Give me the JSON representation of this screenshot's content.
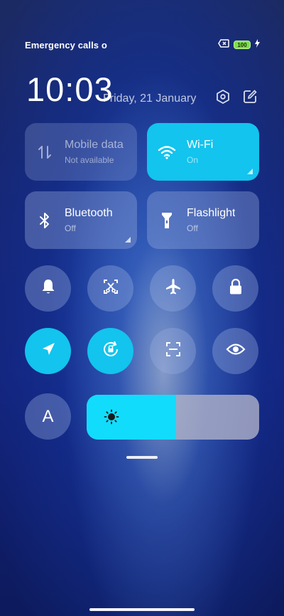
{
  "status_bar": {
    "carrier_text": "Emergency calls o",
    "carrier_text_faded": "",
    "battery_level": "100",
    "icons": [
      "no-sim-icon",
      "battery-icon",
      "charging-bolt-icon"
    ]
  },
  "header": {
    "time": "10:03",
    "date": "Friday, 21 January",
    "icons": [
      "settings-hexagon-icon",
      "edit-icon"
    ]
  },
  "tiles": [
    {
      "key": "mobile_data",
      "label": "Mobile data",
      "status": "Not available",
      "state": "disabled",
      "icon": "mobile-data-arrows-icon"
    },
    {
      "key": "wifi",
      "label": "Wi-Fi",
      "status": "On",
      "state": "active",
      "icon": "wifi-icon"
    },
    {
      "key": "bluetooth",
      "label": "Bluetooth",
      "status": "Off",
      "state": "inactive",
      "icon": "bluetooth-icon"
    },
    {
      "key": "flashlight",
      "label": "Flashlight",
      "status": "Off",
      "state": "inactive",
      "icon": "flashlight-icon"
    }
  ],
  "round_buttons_row1": [
    {
      "icon": "bell-icon",
      "active": false
    },
    {
      "icon": "screenshot-scissors-icon",
      "active": false
    },
    {
      "icon": "airplane-icon",
      "active": false
    },
    {
      "icon": "lock-icon",
      "active": false
    }
  ],
  "round_buttons_row2": [
    {
      "icon": "location-arrow-icon",
      "active": true
    },
    {
      "icon": "auto-rotate-lock-icon",
      "active": true
    },
    {
      "icon": "scan-frame-icon",
      "active": false
    },
    {
      "icon": "eye-icon",
      "active": false
    }
  ],
  "auto_brightness_label": "A",
  "brightness": {
    "level": 0.52,
    "icon": "sun-icon"
  },
  "colors": {
    "accent": "#12c4ee",
    "slider_fill": "#12dcfc"
  }
}
